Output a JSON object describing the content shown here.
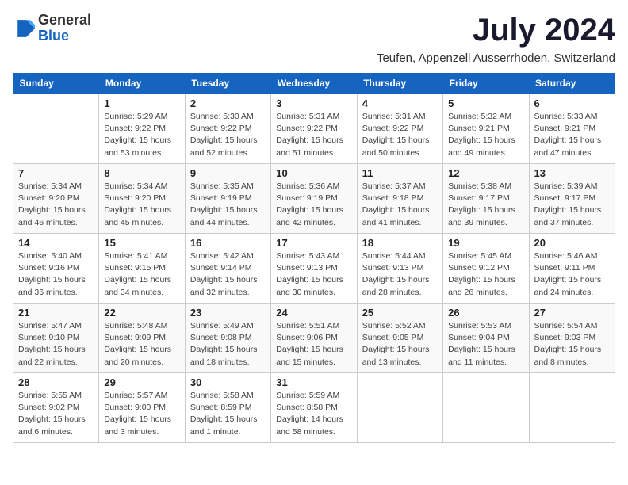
{
  "logo": {
    "general": "General",
    "blue": "Blue"
  },
  "title": "July 2024",
  "subtitle": "Teufen, Appenzell Ausserrhoden, Switzerland",
  "days_header": [
    "Sunday",
    "Monday",
    "Tuesday",
    "Wednesday",
    "Thursday",
    "Friday",
    "Saturday"
  ],
  "weeks": [
    [
      {
        "num": "",
        "info": ""
      },
      {
        "num": "1",
        "info": "Sunrise: 5:29 AM\nSunset: 9:22 PM\nDaylight: 15 hours\nand 53 minutes."
      },
      {
        "num": "2",
        "info": "Sunrise: 5:30 AM\nSunset: 9:22 PM\nDaylight: 15 hours\nand 52 minutes."
      },
      {
        "num": "3",
        "info": "Sunrise: 5:31 AM\nSunset: 9:22 PM\nDaylight: 15 hours\nand 51 minutes."
      },
      {
        "num": "4",
        "info": "Sunrise: 5:31 AM\nSunset: 9:22 PM\nDaylight: 15 hours\nand 50 minutes."
      },
      {
        "num": "5",
        "info": "Sunrise: 5:32 AM\nSunset: 9:21 PM\nDaylight: 15 hours\nand 49 minutes."
      },
      {
        "num": "6",
        "info": "Sunrise: 5:33 AM\nSunset: 9:21 PM\nDaylight: 15 hours\nand 47 minutes."
      }
    ],
    [
      {
        "num": "7",
        "info": "Sunrise: 5:34 AM\nSunset: 9:20 PM\nDaylight: 15 hours\nand 46 minutes."
      },
      {
        "num": "8",
        "info": "Sunrise: 5:34 AM\nSunset: 9:20 PM\nDaylight: 15 hours\nand 45 minutes."
      },
      {
        "num": "9",
        "info": "Sunrise: 5:35 AM\nSunset: 9:19 PM\nDaylight: 15 hours\nand 44 minutes."
      },
      {
        "num": "10",
        "info": "Sunrise: 5:36 AM\nSunset: 9:19 PM\nDaylight: 15 hours\nand 42 minutes."
      },
      {
        "num": "11",
        "info": "Sunrise: 5:37 AM\nSunset: 9:18 PM\nDaylight: 15 hours\nand 41 minutes."
      },
      {
        "num": "12",
        "info": "Sunrise: 5:38 AM\nSunset: 9:17 PM\nDaylight: 15 hours\nand 39 minutes."
      },
      {
        "num": "13",
        "info": "Sunrise: 5:39 AM\nSunset: 9:17 PM\nDaylight: 15 hours\nand 37 minutes."
      }
    ],
    [
      {
        "num": "14",
        "info": "Sunrise: 5:40 AM\nSunset: 9:16 PM\nDaylight: 15 hours\nand 36 minutes."
      },
      {
        "num": "15",
        "info": "Sunrise: 5:41 AM\nSunset: 9:15 PM\nDaylight: 15 hours\nand 34 minutes."
      },
      {
        "num": "16",
        "info": "Sunrise: 5:42 AM\nSunset: 9:14 PM\nDaylight: 15 hours\nand 32 minutes."
      },
      {
        "num": "17",
        "info": "Sunrise: 5:43 AM\nSunset: 9:13 PM\nDaylight: 15 hours\nand 30 minutes."
      },
      {
        "num": "18",
        "info": "Sunrise: 5:44 AM\nSunset: 9:13 PM\nDaylight: 15 hours\nand 28 minutes."
      },
      {
        "num": "19",
        "info": "Sunrise: 5:45 AM\nSunset: 9:12 PM\nDaylight: 15 hours\nand 26 minutes."
      },
      {
        "num": "20",
        "info": "Sunrise: 5:46 AM\nSunset: 9:11 PM\nDaylight: 15 hours\nand 24 minutes."
      }
    ],
    [
      {
        "num": "21",
        "info": "Sunrise: 5:47 AM\nSunset: 9:10 PM\nDaylight: 15 hours\nand 22 minutes."
      },
      {
        "num": "22",
        "info": "Sunrise: 5:48 AM\nSunset: 9:09 PM\nDaylight: 15 hours\nand 20 minutes."
      },
      {
        "num": "23",
        "info": "Sunrise: 5:49 AM\nSunset: 9:08 PM\nDaylight: 15 hours\nand 18 minutes."
      },
      {
        "num": "24",
        "info": "Sunrise: 5:51 AM\nSunset: 9:06 PM\nDaylight: 15 hours\nand 15 minutes."
      },
      {
        "num": "25",
        "info": "Sunrise: 5:52 AM\nSunset: 9:05 PM\nDaylight: 15 hours\nand 13 minutes."
      },
      {
        "num": "26",
        "info": "Sunrise: 5:53 AM\nSunset: 9:04 PM\nDaylight: 15 hours\nand 11 minutes."
      },
      {
        "num": "27",
        "info": "Sunrise: 5:54 AM\nSunset: 9:03 PM\nDaylight: 15 hours\nand 8 minutes."
      }
    ],
    [
      {
        "num": "28",
        "info": "Sunrise: 5:55 AM\nSunset: 9:02 PM\nDaylight: 15 hours\nand 6 minutes."
      },
      {
        "num": "29",
        "info": "Sunrise: 5:57 AM\nSunset: 9:00 PM\nDaylight: 15 hours\nand 3 minutes."
      },
      {
        "num": "30",
        "info": "Sunrise: 5:58 AM\nSunset: 8:59 PM\nDaylight: 15 hours\nand 1 minute."
      },
      {
        "num": "31",
        "info": "Sunrise: 5:59 AM\nSunset: 8:58 PM\nDaylight: 14 hours\nand 58 minutes."
      },
      {
        "num": "",
        "info": ""
      },
      {
        "num": "",
        "info": ""
      },
      {
        "num": "",
        "info": ""
      }
    ]
  ]
}
